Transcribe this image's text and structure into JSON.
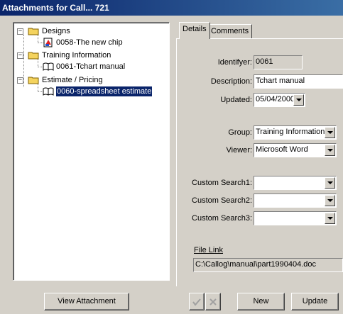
{
  "window": {
    "title": "Attachments for Call... 721"
  },
  "tree": {
    "nodes": [
      {
        "label": "Designs"
      },
      {
        "label": "0058-The new chip"
      },
      {
        "label": "Training Information"
      },
      {
        "label": "0061-Tchart manual"
      },
      {
        "label": "Estimate / Pricing"
      },
      {
        "label": "0060-spreadsheet estimate"
      }
    ],
    "selected_index": 5
  },
  "tabs": [
    {
      "label": "Details"
    },
    {
      "label": "Comments"
    }
  ],
  "details": {
    "identifier_label": "Identifyer:",
    "identifier_value": "0061",
    "description_label": "Description:",
    "description_value": "Tchart manual",
    "updated_label": "Updated:",
    "updated_value": "05/04/2000",
    "group_label": "Group:",
    "group_value": "Training Information",
    "viewer_label": "Viewer:",
    "viewer_value": "Microsoft Word",
    "custom1_label": "Custom Search1:",
    "custom1_value": "",
    "custom2_label": "Custom Search2:",
    "custom2_value": "",
    "custom3_label": "Custom Search3:",
    "custom3_value": "",
    "file_link_label": "File Link",
    "file_link_value": "C:\\Callog\\manual\\part1990404.doc"
  },
  "buttons": {
    "view_attachment": "View Attachment",
    "new": "New",
    "update": "Update"
  },
  "icons": {
    "folder": "folder-icon",
    "chip_doc": "document-icon",
    "book": "book-icon",
    "check": "checkmark-icon",
    "cross": "cross-icon"
  },
  "colors": {
    "title_bar": "#0a246a",
    "selection": "#0a246a",
    "face": "#d4d0c8"
  }
}
